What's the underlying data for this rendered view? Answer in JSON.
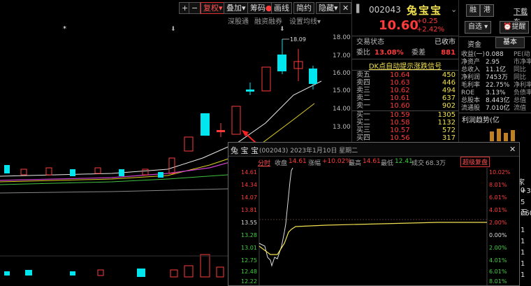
{
  "toolbar": {
    "plus": "+",
    "minus": "−",
    "buttons": [
      "复权",
      "叠加",
      "筹码",
      "画线",
      "简约",
      "隐藏"
    ],
    "close": "✕",
    "sub": [
      "深股通",
      "融资融券",
      "设置均线"
    ],
    "peak_label": "18.09"
  },
  "price_axis": [
    "18.00",
    "17.00",
    "16.00",
    "15.00",
    "14.00",
    "13.00"
  ],
  "stock": {
    "code": "002043",
    "name": "兔宝宝",
    "price": "10.60",
    "change": "+0.25",
    "change_pct": "+2.42%"
  },
  "status": {
    "label": "交易状态",
    "value": "已收市"
  },
  "ratio": {
    "l1": "委比",
    "v1": "13.08%",
    "l2": "委差",
    "v2": "881"
  },
  "banner": "DK点自动提示涨跌信号",
  "asks": [
    {
      "label": "卖五",
      "price": "10.64",
      "vol": "450"
    },
    {
      "label": "卖四",
      "price": "10.63",
      "vol": "446"
    },
    {
      "label": "卖三",
      "price": "10.62",
      "vol": "494"
    },
    {
      "label": "卖二",
      "price": "10.61",
      "vol": "637"
    },
    {
      "label": "卖一",
      "price": "10.60",
      "vol": "902"
    }
  ],
  "bids": [
    {
      "label": "买一",
      "price": "10.59",
      "vol": "1305"
    },
    {
      "label": "买二",
      "price": "10.58",
      "vol": "1132"
    },
    {
      "label": "买三",
      "price": "10.57",
      "vol": "572"
    },
    {
      "label": "买四",
      "price": "10.56",
      "vol": "317"
    }
  ],
  "right_panel": {
    "tabs": [
      "融",
      "港"
    ],
    "download": "下载东",
    "buttons": [
      "自选",
      "提醒"
    ],
    "info_tabs": [
      "资金",
      "基本"
    ],
    "fin": [
      {
        "l": "收益(一)",
        "v": "0.088",
        "u": "PE(动"
      },
      {
        "l": "净资产",
        "v": "2.95",
        "u": "市净率"
      },
      {
        "l": "总收入",
        "v": "11.1亿",
        "u": "同比"
      },
      {
        "l": "净利润",
        "v": "7453万",
        "u": "同比"
      },
      {
        "l": "毛利率",
        "v": "22.75%",
        "u": "净利率"
      },
      {
        "l": "ROE",
        "v": "3.13%",
        "u": "负债率"
      },
      {
        "l": "总股本",
        "v": "8.443亿",
        "u": "总值"
      },
      {
        "l": "流通股",
        "v": "7.010亿",
        "u": "流值"
      }
    ],
    "trend_label": "利润趋势(亿",
    "partials": [
      "家(0",
      "+31",
      "5万",
      "060",
      "1",
      "1",
      "1",
      "1",
      "1"
    ]
  },
  "popup": {
    "name_chars": [
      "兔",
      "宝",
      "宝"
    ],
    "meta": "(002043) 2023年1月10日 星期二",
    "tab": "分时",
    "fields": [
      {
        "l": "收盘",
        "v": "14.61"
      },
      {
        "l": "涨幅",
        "v": "+10.02%"
      },
      {
        "l": "最高",
        "v": "14.61"
      },
      {
        "l": "最低",
        "v": "12.41"
      },
      {
        "l": "成交",
        "v": "68.3万"
      }
    ],
    "ext_button": "超级复盘",
    "close": "✕",
    "left_axis": [
      "14.61",
      "14.34",
      "14.07",
      "13.81",
      "13.55",
      "13.28",
      "13.01",
      "12.75",
      "12.48",
      "12.22"
    ],
    "right_axis": [
      "10.02%",
      "8.01%",
      "6.01%",
      "4.01%",
      "2.00%",
      "0.00%",
      "2.00%",
      "4.01%",
      "6.01%",
      "8.01%"
    ]
  },
  "colors": {
    "up": "#ff3a3a",
    "down": "#00e5ee",
    "accent": "#f0e050"
  }
}
